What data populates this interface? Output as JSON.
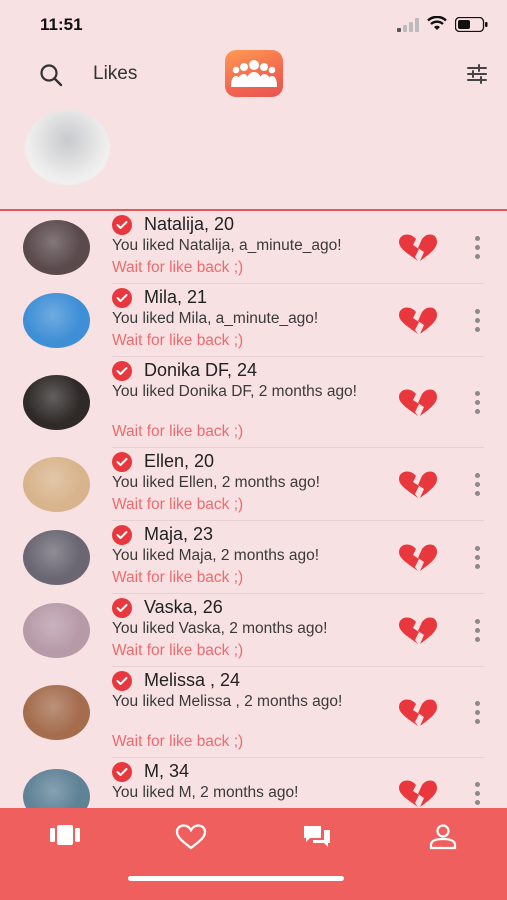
{
  "status": {
    "time": "11:51"
  },
  "header": {
    "title": "Likes"
  },
  "colors": {
    "accent": "#ee5f5d",
    "wait_text": "#ee6a6e",
    "check": "#e8383d",
    "background": "#f7e1e2"
  },
  "list": [
    {
      "name": "Natalija, 20",
      "message": "You liked Natalija, a_minute_ago!",
      "wait": "Wait for like back ;)",
      "avatar_color": "#5a4a4c"
    },
    {
      "name": "Mila, 21",
      "message": "You liked Mila, a_minute_ago!",
      "wait": "Wait for like back ;)",
      "avatar_color": "#3f8fd6"
    },
    {
      "name": "Donika DF, 24",
      "message": "You liked Donika DF, 2 months ago!",
      "wait": "Wait for like back ;)",
      "avatar_color": "#2f2a28"
    },
    {
      "name": "Ellen, 20",
      "message": "You liked Ellen, 2 months ago!",
      "wait": "Wait for like back ;)",
      "avatar_color": "#d8b48c"
    },
    {
      "name": "Maja, 23",
      "message": "You liked Maja, 2 months ago!",
      "wait": "Wait for like back ;)",
      "avatar_color": "#6a6672"
    },
    {
      "name": "Vaska, 26",
      "message": "You liked Vaska, 2 months ago!",
      "wait": "Wait for like back ;)",
      "avatar_color": "#b79aa8"
    },
    {
      "name": "Melissa , 24",
      "message": "You liked Melissa , 2 months ago!",
      "wait": "Wait for like back ;)",
      "avatar_color": "#a56d4e"
    },
    {
      "name": "M, 34",
      "message": "You liked M, 2 months ago!",
      "wait": "",
      "avatar_color": "#5e8296"
    }
  ],
  "nav": {
    "items": [
      {
        "icon": "cards-icon"
      },
      {
        "icon": "heart-icon"
      },
      {
        "icon": "chat-icon"
      },
      {
        "icon": "profile-icon"
      }
    ]
  }
}
